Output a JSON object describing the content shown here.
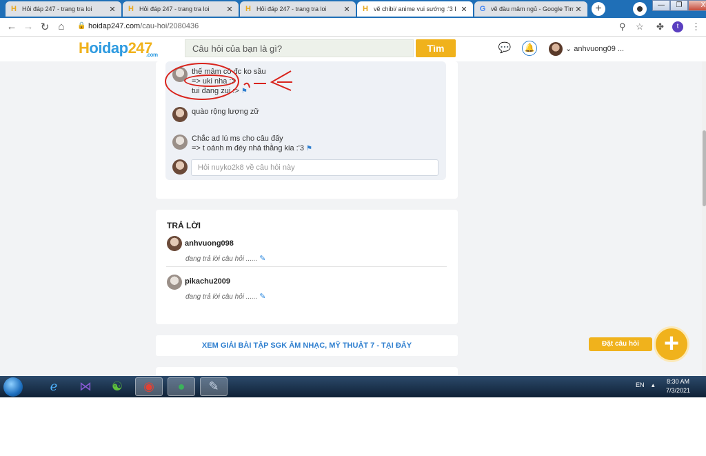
{
  "browser": {
    "tabs": [
      {
        "title": "Hỏi đáp 247 - trang tra loi",
        "favicon": "H",
        "close": "✕"
      },
      {
        "title": "Hỏi đáp 247 - trang tra loi",
        "favicon": "H",
        "close": "✕"
      },
      {
        "title": "Hỏi đáp 247 - trang tra loi",
        "favicon": "H",
        "close": "✕"
      },
      {
        "title": "vẽ chibi/ anime vui sướng :'3 I",
        "favicon": "H",
        "close": "✕"
      },
      {
        "title": "vẽ đàu mâm ngủ - Google Tìm",
        "favicon": "G",
        "close": "✕"
      }
    ],
    "new_tab": "+",
    "url_host": "hoidap247.com",
    "url_path": "/cau-hoi/2080436",
    "profile_initial": "t",
    "window_buttons": [
      "—",
      "❐",
      "X"
    ]
  },
  "site": {
    "logo_h": "H",
    "logo_oidap": "oidap",
    "logo_247": "247",
    "logo_com": ".com",
    "search_placeholder": "Câu hỏi của bạn là gì?",
    "search_button": "Tìm",
    "username": "anhvuong09 ..."
  },
  "comments": [
    {
      "lines": [
        "thế mâm có đc ko sầu",
        "=> uki nha :>",
        "tui đang zui :>"
      ]
    },
    {
      "lines": [
        "quào rộng lượng zữ"
      ]
    },
    {
      "lines": [
        "Chắc ad lú ms cho câu đấy",
        "=> t oánh m đéy nhá thằng kia :'3"
      ]
    }
  ],
  "comment_input_placeholder": "Hỏi nuyko2k8 về câu hỏi này",
  "answers": {
    "title": "TRẢ LỜI",
    "items": [
      {
        "name": "anhvuong098",
        "status": "đang trả lời câu hỏi ......"
      },
      {
        "name": "pikachu2009",
        "status": "đang trả lời câu hỏi ......"
      }
    ]
  },
  "banner": "XEM GIẢI BÀI TẬP SGK ÂM NHẠC, MỸ THUẬT 7 - TẠI ĐÂY",
  "ask_button": "Đặt câu hỏi",
  "taskbar": {
    "lang": "EN",
    "time": "8:30 AM",
    "date": "7/3/2021"
  }
}
